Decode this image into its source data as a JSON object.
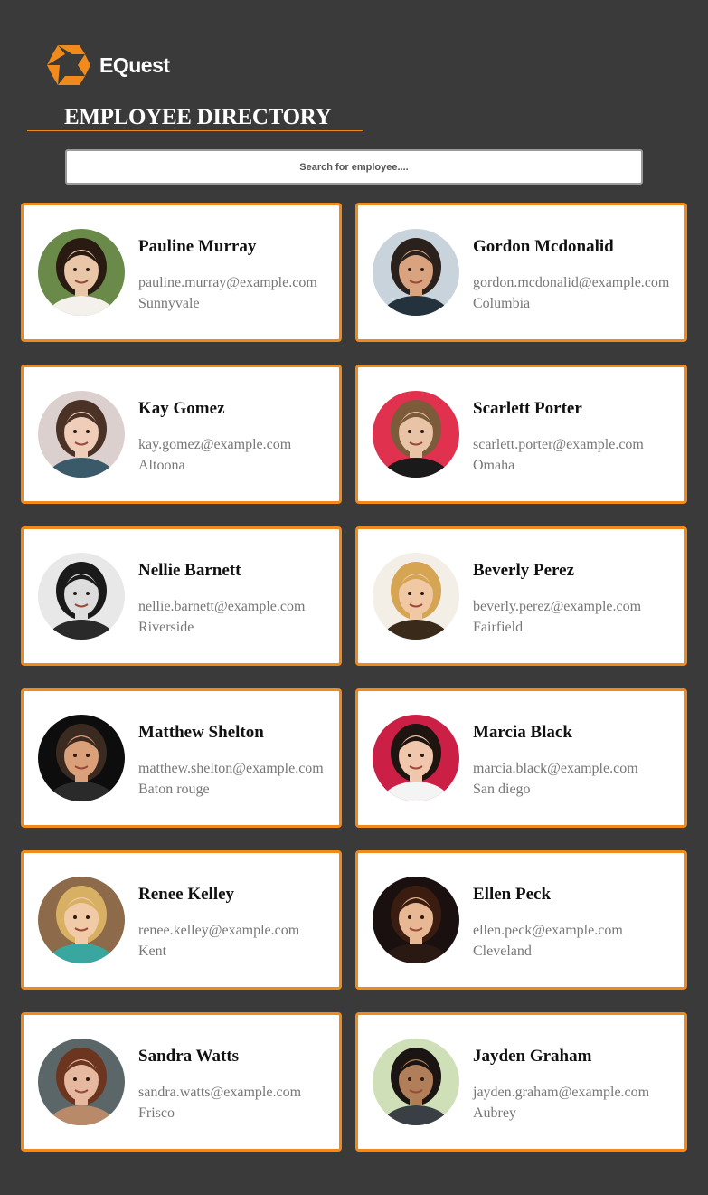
{
  "brand": {
    "logo_text": "EQuest",
    "accent": "#f08a1c"
  },
  "header": {
    "title": "EMPLOYEE DIRECTORY"
  },
  "search": {
    "placeholder": "Search for employee....",
    "value": ""
  },
  "employees": [
    {
      "name": "Pauline Murray",
      "email": "pauline.murray@example.com",
      "city": "Sunnyvale",
      "avatar": {
        "skin": "#e9c6a8",
        "hair": "#2a1b12",
        "bg": "#6a8a4a",
        "shirt": "#f4f1ec"
      }
    },
    {
      "name": "Gordon Mcdonalid",
      "email": "gordon.mcdonalid@example.com",
      "city": "Columbia",
      "avatar": {
        "skin": "#d8a37e",
        "hair": "#2b211c",
        "bg": "#c9d3dc",
        "shirt": "#24323d"
      }
    },
    {
      "name": "Kay Gomez",
      "email": "kay.gomez@example.com",
      "city": "Altoona",
      "avatar": {
        "skin": "#f0cdb9",
        "hair": "#4a3226",
        "bg": "#dcd0cf",
        "shirt": "#3a5a6a"
      }
    },
    {
      "name": "Scarlett Porter",
      "email": "scarlett.porter@example.com",
      "city": "Omaha",
      "avatar": {
        "skin": "#e9c3a6",
        "hair": "#7b5b3a",
        "bg": "#e0314f",
        "shirt": "#1a1a1a"
      }
    },
    {
      "name": "Nellie Barnett",
      "email": "nellie.barnett@example.com",
      "city": "Riverside",
      "avatar": {
        "skin": "#dddddd",
        "hair": "#1a1a1a",
        "bg": "#e8e8e8",
        "shirt": "#2a2a2a"
      }
    },
    {
      "name": "Beverly Perez",
      "email": "beverly.perez@example.com",
      "city": "Fairfield",
      "avatar": {
        "skin": "#f0c8a4",
        "hair": "#d6a554",
        "bg": "#f3efe6",
        "shirt": "#3a2a1a"
      }
    },
    {
      "name": "Matthew Shelton",
      "email": "matthew.shelton@example.com",
      "city": "Baton rouge",
      "avatar": {
        "skin": "#d9a07a",
        "hair": "#3b2a1f",
        "bg": "#0d0d0d",
        "shirt": "#2a2a2a"
      }
    },
    {
      "name": "Marcia Black",
      "email": "marcia.black@example.com",
      "city": "San diego",
      "avatar": {
        "skin": "#f0c7ac",
        "hair": "#1e1410",
        "bg": "#cc1f46",
        "shirt": "#f4f4f4"
      }
    },
    {
      "name": "Renee Kelley",
      "email": "renee.kelley@example.com",
      "city": "Kent",
      "avatar": {
        "skin": "#f1caa8",
        "hair": "#d8b063",
        "bg": "#8c6a4a",
        "shirt": "#3aa6a0"
      }
    },
    {
      "name": "Ellen Peck",
      "email": "ellen.peck@example.com",
      "city": "Cleveland",
      "avatar": {
        "skin": "#e8b794",
        "hair": "#3a1d10",
        "bg": "#1a1010",
        "shirt": "#2a1812"
      }
    },
    {
      "name": "Sandra Watts",
      "email": "sandra.watts@example.com",
      "city": "Frisco",
      "avatar": {
        "skin": "#e6b8a0",
        "hair": "#6b3520",
        "bg": "#5a6668",
        "shirt": "#b88a6a"
      }
    },
    {
      "name": "Jayden Graham",
      "email": "jayden.graham@example.com",
      "city": "Aubrey",
      "avatar": {
        "skin": "#b07f5a",
        "hair": "#1a1412",
        "bg": "#cfe0b8",
        "shirt": "#3a3f45"
      }
    }
  ]
}
